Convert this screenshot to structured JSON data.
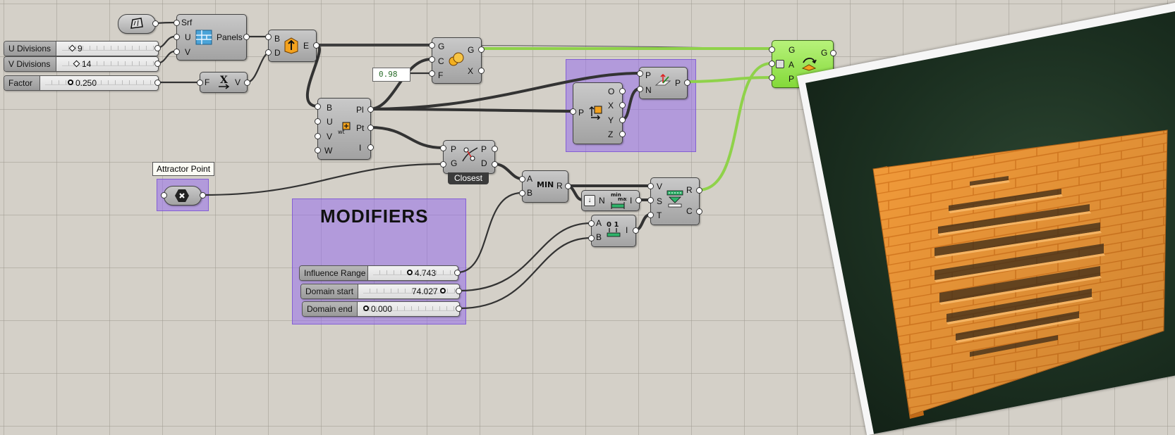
{
  "canvas": {
    "bg": "#d4d0c8",
    "wire_green": "#8fd24a",
    "group_color": "#a078ea"
  },
  "sliders": [
    {
      "label": "U Divisions",
      "value": "9"
    },
    {
      "label": "V Divisions",
      "value": "14"
    },
    {
      "label": "Factor",
      "value": "0.250"
    }
  ],
  "modifier_sliders": [
    {
      "label": "Influence Range",
      "value": "4.743"
    },
    {
      "label": "Domain start",
      "value": "74.027"
    },
    {
      "label": "Domain end",
      "value": "0.000"
    }
  ],
  "components": {
    "surface_param": {
      "icon": "surface-icon"
    },
    "panels": {
      "inputs": [
        "Srf",
        "U",
        "V"
      ],
      "outputs": [
        "Panels"
      ],
      "icon": "panels-grid-icon"
    },
    "brep_edges": {
      "inputs": [
        "B",
        "D"
      ],
      "outputs": [
        "E"
      ],
      "icon": "extrude-icon"
    },
    "multiply": {
      "inputs": [
        "F"
      ],
      "outputs": [
        "V"
      ],
      "icon": "multiply-x-icon"
    },
    "box_params": {
      "inputs": [
        "B",
        "U",
        "V",
        "W"
      ],
      "outputs": [
        "Pl",
        "Pt",
        "I"
      ],
      "icon": "point-on-box-icon"
    },
    "scale_gc": {
      "inputs": [
        "G",
        "C",
        "F"
      ],
      "outputs": [
        "G",
        "X"
      ],
      "icon": "scale-spheres-icon"
    },
    "deconstruct_plane": {
      "inputs": [
        "P"
      ],
      "outputs": [
        "O",
        "X",
        "Y",
        "Z"
      ],
      "icon": "deconstruct-plane-icon"
    },
    "plane_normal": {
      "inputs": [
        "P",
        "N"
      ],
      "outputs": [
        "P"
      ],
      "icon": "plane-normal-icon"
    },
    "orient": {
      "inputs": [
        "G",
        "A",
        "P"
      ],
      "outputs": [
        "G",
        "X"
      ],
      "icon": "orient-icon"
    },
    "closest_point": {
      "inputs": [
        "P",
        "G"
      ],
      "outputs": [
        "P",
        "D"
      ],
      "icon": "closest-point-icon",
      "label": "Closest"
    },
    "min": {
      "inputs": [
        "A",
        "B"
      ],
      "outputs": [
        "R"
      ],
      "icon_text": "MIN"
    },
    "bounds": {
      "inputs": [
        "N"
      ],
      "outputs": [
        "I"
      ],
      "icon": "bounds-icon",
      "icon_text_top": "min",
      "icon_text_bot": "max"
    },
    "construct_domain": {
      "inputs": [
        "A",
        "B"
      ],
      "outputs": [
        "I"
      ],
      "icon": "domain-icon",
      "icon_text": "0 1"
    },
    "remap": {
      "inputs": [
        "V",
        "S",
        "T"
      ],
      "outputs": [
        "R",
        "C"
      ],
      "icon": "remap-icon"
    }
  },
  "panel_value": "0.98",
  "attractor": {
    "tooltip": "Attractor Point",
    "icon": "point-param-icon"
  },
  "group_title": "MODIFIERS",
  "preview": {
    "icon": "brick-wall-preview"
  }
}
